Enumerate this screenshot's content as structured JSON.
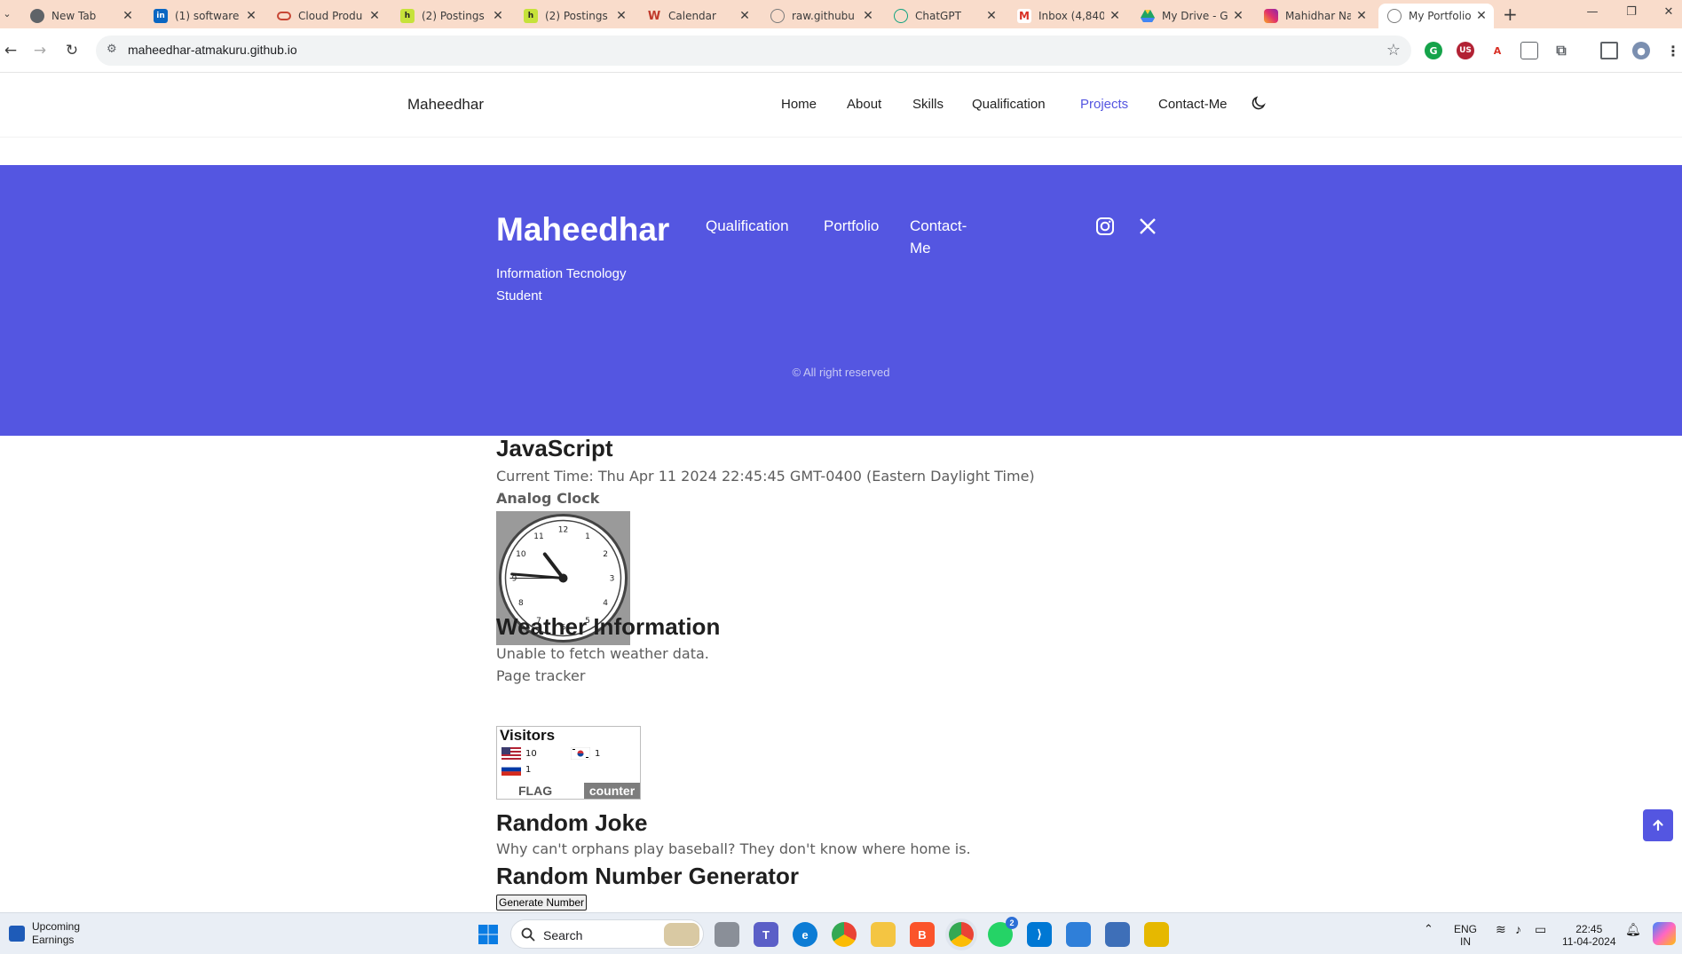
{
  "browser": {
    "tabs": [
      {
        "label": "New Tab",
        "icon": "chrome-icon",
        "color": "#5f6368"
      },
      {
        "label": "(1) software",
        "icon": "linkedin-icon",
        "color": "#0a66c2"
      },
      {
        "label": "Cloud Produ",
        "icon": "oracle-icon",
        "color": "#c74634"
      },
      {
        "label": "(2) Postings",
        "icon": "handshake-icon",
        "color": "#c6e23a"
      },
      {
        "label": "(2) Postings",
        "icon": "handshake-icon",
        "color": "#c6e23a"
      },
      {
        "label": "Calendar",
        "icon": "calendar-icon",
        "color": "#c0392b"
      },
      {
        "label": "raw.githubu",
        "icon": "globe-icon",
        "color": "#7a7a7a"
      },
      {
        "label": "ChatGPT",
        "icon": "chatgpt-icon",
        "color": "#10a37f"
      },
      {
        "label": "Inbox (4,840",
        "icon": "gmail-icon",
        "color": "#d93025"
      },
      {
        "label": "My Drive - G",
        "icon": "drive-icon",
        "color": "#1fa463"
      },
      {
        "label": "Mahidhar Na",
        "icon": "instagram-icon",
        "color": "#e1306c"
      },
      {
        "label": "My Portfolio",
        "icon": "globe-icon",
        "color": "#7a7a7a",
        "active": true
      }
    ],
    "url": "maheedhar-atmakuru.github.io"
  },
  "site": {
    "brand": "Maheedhar",
    "nav": [
      "Home",
      "About",
      "Skills",
      "Qualification",
      "Projects",
      "Contact-Me"
    ],
    "active_nav": "Projects",
    "accent": "#5456e1"
  },
  "footer": {
    "title": "Maheedhar",
    "subtitle": "Information Tecnology Student",
    "links": [
      "Qualification",
      "Portfolio",
      "Contact-Me"
    ],
    "copyright": "© All right reserved"
  },
  "content": {
    "js_heading": "JavaScript",
    "current_time": "Current Time: Thu Apr 11 2024 22:45:45 GMT-0400 (Eastern Daylight Time)",
    "clock_label": "Analog Clock",
    "clock_time": "22:45:45",
    "weather_heading": "Weather Information",
    "weather_text": "Unable to fetch weather data.",
    "tracker_label": "Page tracker",
    "visitors": {
      "title": "Visitors",
      "entries": [
        {
          "country": "US",
          "count": "10"
        },
        {
          "country": "KR",
          "count": "1"
        },
        {
          "country": "RU",
          "count": "1"
        }
      ],
      "badge_left": "FLAG",
      "badge_right": "counter"
    },
    "joke_heading": "Random Joke",
    "joke_text": "Why can't orphans play baseball? They don't know where home is.",
    "rng_heading": "Random Number Generator",
    "rng_button": "Generate Number"
  },
  "taskbar": {
    "widget_line1": "Upcoming",
    "widget_line2": "Earnings",
    "search_label": "Search",
    "lang1": "ENG",
    "lang2": "IN",
    "time": "22:45",
    "date": "11-04-2024",
    "whatsapp_badge": "2"
  }
}
